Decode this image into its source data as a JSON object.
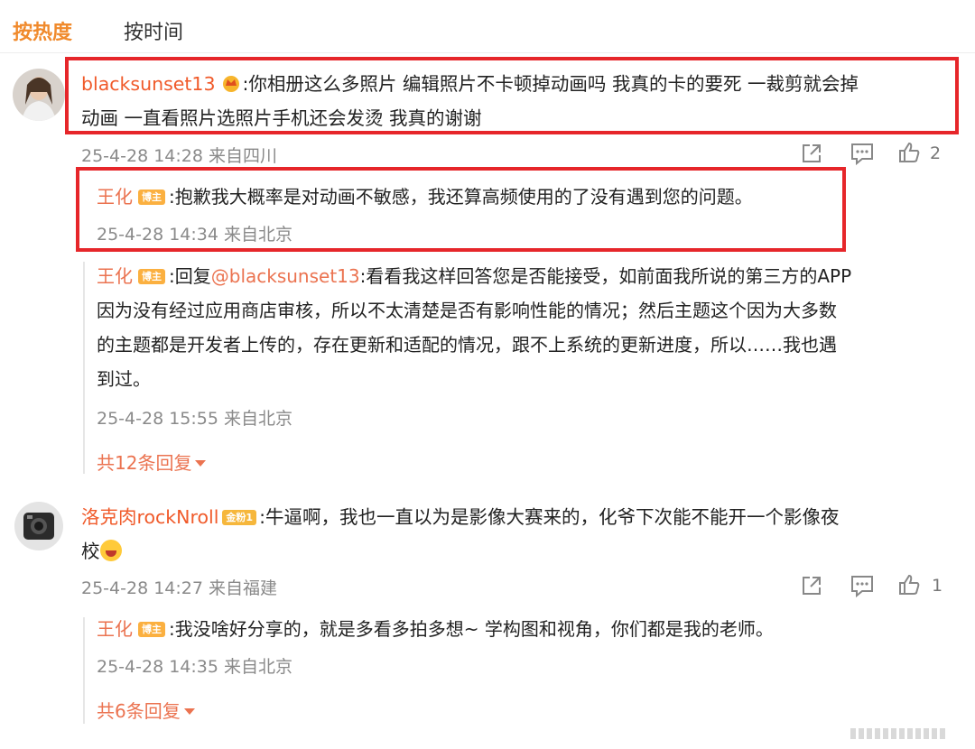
{
  "tabs": {
    "hot": "按热度",
    "time": "按时间"
  },
  "comment1": {
    "user": "blacksunset13",
    "text_line1": ":你相册这么多照片 编辑照片不卡顿掉动画吗 我真的卡的要死 一裁剪就会掉",
    "text_line2": "动画 一直看照片选照片手机还会发烫 我真的谢谢",
    "meta": "25-4-28 14:28 来自四川",
    "like_count": "2",
    "replies": [
      {
        "user": "王化",
        "badge": "博主",
        "text": ":抱歉我大概率是对动画不敏感，我还算高频使用的了没有遇到您的问题。",
        "meta": "25-4-28 14:34 来自北京"
      },
      {
        "user": "王化",
        "badge": "博主",
        "prefix": ":回复",
        "mention": "@blacksunset13",
        "line1": ":看看我这样回答您是否能接受，如前面我所说的第三方的APP",
        "line2": "因为没有经过应用商店审核，所以不太清楚是否有影响性能的情况；然后主题这个因为大多数",
        "line3": "的主题都是开发者上传的，存在更新和适配的情况，跟不上系统的更新进度，所以……我也遇",
        "line4": "到过。",
        "meta": "25-4-28 15:55 来自北京"
      }
    ],
    "more": "共12条回复"
  },
  "comment2": {
    "user": "洛克肉rockNroll",
    "badge": "金粉1",
    "text_line1": ":牛逼啊，我也一直以为是影像大赛来的，化爷下次能不能开一个影像夜",
    "text_line2": "校",
    "meta": "25-4-28 14:27 来自福建",
    "like_count": "1",
    "reply": {
      "user": "王化",
      "badge": "博主",
      "text": ":我没啥好分享的，就是多看多拍多想~ 学构图和视角，你们都是我的老师。",
      "meta": "25-4-28 14:35 来自北京"
    },
    "more": "共6条回复"
  },
  "icons": [
    "share-icon",
    "comment-icon",
    "like-icon",
    "chevron-down-icon"
  ],
  "colors": {
    "accent": "#eb7350",
    "highlight_box": "#e6262a",
    "active_tab": "#f08a2c"
  }
}
